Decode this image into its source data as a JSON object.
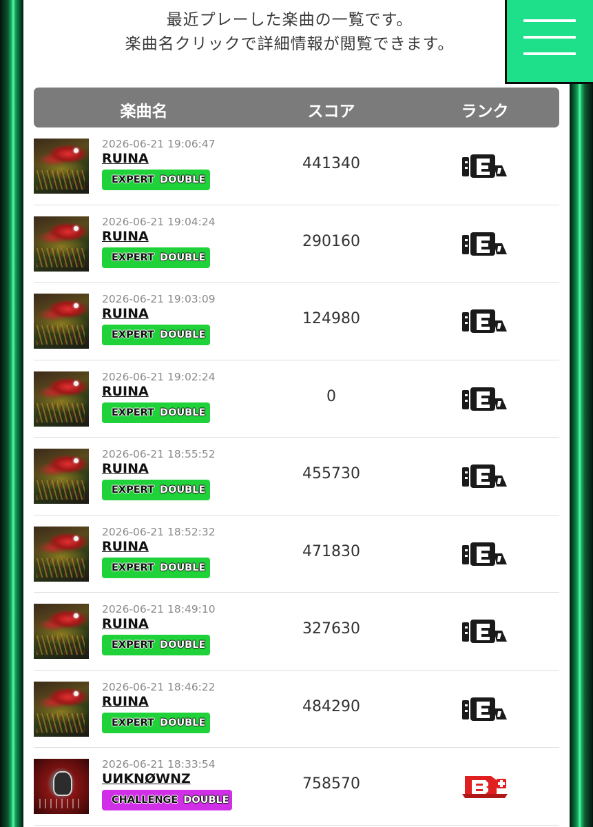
{
  "intro": {
    "line1": "最近プレーした楽曲の一覧です。",
    "line2": "楽曲名クリックで詳細情報が閲覧できます。"
  },
  "menu": {
    "icon": "hamburger-menu-icon"
  },
  "colors": {
    "accent": "#1fe08a",
    "expert_badge": "#20d23a",
    "challenge_badge": "#d12ee8",
    "header_bg": "#7b7b7b",
    "rank_e": "#1a1a1a",
    "rank_b_plus": "#e02020"
  },
  "table": {
    "headers": {
      "song": "楽曲名",
      "score": "スコア",
      "rank": "ランク"
    },
    "rows": [
      {
        "played_at": "2026-06-21 19:06:47",
        "title": "RUINA",
        "difficulty": "EXPERT",
        "style": "DOUBLE",
        "score": "441340",
        "rank": "E",
        "jacket": "ruina"
      },
      {
        "played_at": "2026-06-21 19:04:24",
        "title": "RUINA",
        "difficulty": "EXPERT",
        "style": "DOUBLE",
        "score": "290160",
        "rank": "E",
        "jacket": "ruina"
      },
      {
        "played_at": "2026-06-21 19:03:09",
        "title": "RUINA",
        "difficulty": "EXPERT",
        "style": "DOUBLE",
        "score": "124980",
        "rank": "E",
        "jacket": "ruina"
      },
      {
        "played_at": "2026-06-21 19:02:24",
        "title": "RUINA",
        "difficulty": "EXPERT",
        "style": "DOUBLE",
        "score": "0",
        "rank": "E",
        "jacket": "ruina"
      },
      {
        "played_at": "2026-06-21 18:55:52",
        "title": "RUINA",
        "difficulty": "EXPERT",
        "style": "DOUBLE",
        "score": "455730",
        "rank": "E",
        "jacket": "ruina"
      },
      {
        "played_at": "2026-06-21 18:52:32",
        "title": "RUINA",
        "difficulty": "EXPERT",
        "style": "DOUBLE",
        "score": "471830",
        "rank": "E",
        "jacket": "ruina"
      },
      {
        "played_at": "2026-06-21 18:49:10",
        "title": "RUINA",
        "difficulty": "EXPERT",
        "style": "DOUBLE",
        "score": "327630",
        "rank": "E",
        "jacket": "ruina"
      },
      {
        "played_at": "2026-06-21 18:46:22",
        "title": "RUINA",
        "difficulty": "EXPERT",
        "style": "DOUBLE",
        "score": "484290",
        "rank": "E",
        "jacket": "ruina"
      },
      {
        "played_at": "2026-06-21 18:33:54",
        "title": "UИKNØWNZ",
        "difficulty": "CHALLENGE",
        "style": "DOUBLE",
        "score": "758570",
        "rank": "B+",
        "jacket": "unknownz"
      }
    ]
  }
}
